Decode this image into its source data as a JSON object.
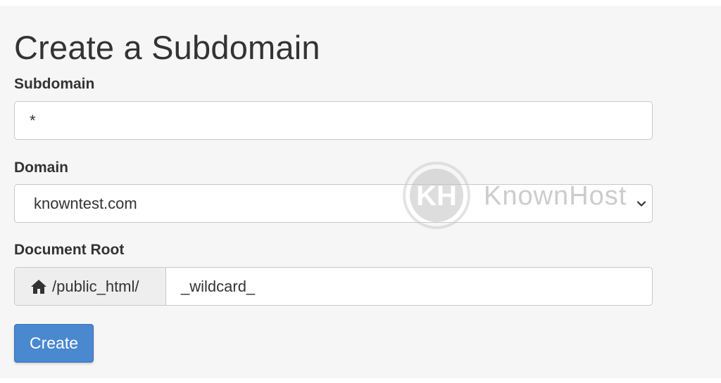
{
  "page": {
    "title": "Create a Subdomain"
  },
  "subdomain": {
    "label": "Subdomain",
    "value": "*"
  },
  "domain": {
    "label": "Domain",
    "selected": "knowntest.com"
  },
  "document_root": {
    "label": "Document Root",
    "prefix": "/public_html/",
    "value": "_wildcard_"
  },
  "actions": {
    "create_label": "Create"
  },
  "watermark": {
    "logo_text": "KnownHost"
  },
  "colors": {
    "button": "#4a88cf",
    "panel_bg": "#f6f6f6",
    "text": "#333333"
  }
}
